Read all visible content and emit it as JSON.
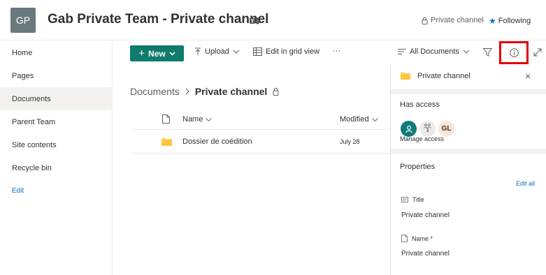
{
  "header": {
    "logo_initials": "GP",
    "site_title": "Gab Private Team - Private channel",
    "private_label": "Private channel",
    "following_label": "Following",
    "brand_color": "#0f7b6c"
  },
  "nav": {
    "items": [
      {
        "label": "Home"
      },
      {
        "label": "Pages"
      },
      {
        "label": "Documents",
        "selected": true
      },
      {
        "label": "Parent Team"
      },
      {
        "label": "Site contents"
      },
      {
        "label": "Recycle bin"
      }
    ],
    "edit_label": "Edit"
  },
  "commandbar": {
    "new_label": "New",
    "upload_label": "Upload",
    "grid_label": "Edit in grid view",
    "more_label": "···",
    "view_label": "All Documents"
  },
  "breadcrumb": {
    "root": "Documents",
    "current": "Private channel"
  },
  "list": {
    "columns": {
      "name": "Name",
      "modified": "Modified"
    },
    "rows": [
      {
        "name": "Dossier de coédition",
        "modified": "July 28"
      }
    ]
  },
  "panel": {
    "title": "Private channel",
    "access": {
      "title": "Has access",
      "group_count": "3",
      "member_initials": "GL",
      "manage_label": "Manage access"
    },
    "properties": {
      "title": "Properties",
      "edit_all_label": "Edit all",
      "fields": [
        {
          "label": "Title",
          "value": "Private channel"
        },
        {
          "label": "Name *",
          "value": "Private channel"
        }
      ]
    }
  }
}
